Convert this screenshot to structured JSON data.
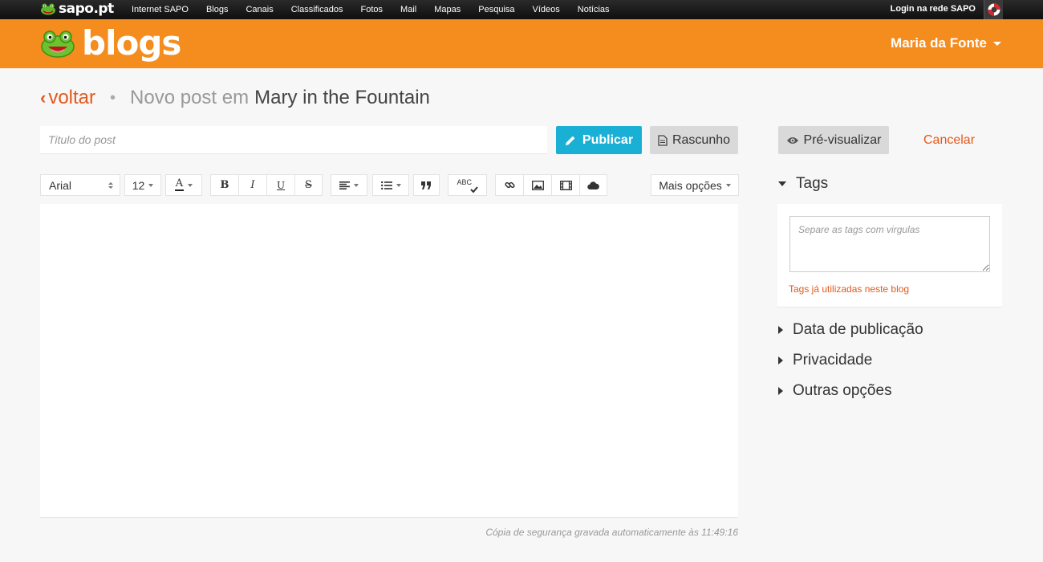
{
  "topbar": {
    "logo_text": "sapo.pt",
    "nav": [
      "Internet SAPO",
      "Blogs",
      "Canais",
      "Classificados",
      "Fotos",
      "Mail",
      "Mapas",
      "Pesquisa",
      "Vídeos",
      "Notícias"
    ],
    "login_text": "Login na rede SAPO"
  },
  "header": {
    "brand": "blogs",
    "user_name": "Maria da Fonte"
  },
  "breadcrumb": {
    "back_label": "voltar",
    "separator": "•",
    "prefix": "Novo post em",
    "blog_name": "Mary in the Fountain"
  },
  "post": {
    "title_placeholder": "Titulo do post",
    "publish_label": "Publicar",
    "draft_label": "Rascunho",
    "preview_label": "Pré-visualizar",
    "cancel_label": "Cancelar"
  },
  "toolbar": {
    "font_family": "Arial",
    "font_size": "12",
    "text_color_letter": "A",
    "bold": "B",
    "italic": "I",
    "underline": "U",
    "strike": "S",
    "spellcheck": "ABC",
    "more_options": "Mais opções"
  },
  "editor": {
    "backup_text": "Cópia de segurança gravada automaticamente às 11:49:16"
  },
  "sidebar": {
    "tags_title": "Tags",
    "tags_placeholder": "Separe as tags com virgulas",
    "tags_link": "Tags já utilizadas neste blog",
    "sections": [
      "Data de publicação",
      "Privacidade",
      "Outras opções"
    ]
  },
  "colors": {
    "brand_orange": "#f48c1e",
    "accent_red": "#e3591c",
    "publish_blue": "#1ab0d6"
  }
}
